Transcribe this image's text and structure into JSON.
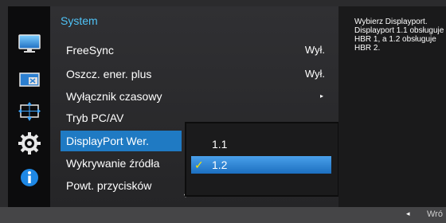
{
  "sidebar": {
    "icons": [
      "monitor-icon",
      "picture-size-icon",
      "position-icon",
      "settings-gear-icon",
      "information-icon"
    ]
  },
  "menu": {
    "title": "System",
    "items": [
      {
        "label": "FreeSync",
        "value": "Wył."
      },
      {
        "label": "Oszcz. ener. plus",
        "value": "Wył."
      },
      {
        "label": "Wyłącznik czasowy",
        "value": "▸"
      },
      {
        "label": "Tryb PC/AV",
        "value": ""
      },
      {
        "label": "DisplayPort Wer.",
        "value": ""
      },
      {
        "label": "Wykrywanie źródła",
        "value": ""
      },
      {
        "label": "Powt. przycisków",
        "value": ""
      }
    ],
    "scroll_indicator": "▾"
  },
  "submenu": {
    "options": [
      "1.1",
      "1.2"
    ],
    "selected": "1.2",
    "check_mark": "✓"
  },
  "info_panel": {
    "text": "Wybierz Displayport. Displayport 1.1 obsługuje HBR 1, a 1.2 obsługuje HBR 2."
  },
  "footer": {
    "back_icon": "◂",
    "back_label": "Wró"
  },
  "colors": {
    "accent": "#4fc3f7",
    "selected": "#1f7ac3",
    "check": "#ffe700"
  }
}
